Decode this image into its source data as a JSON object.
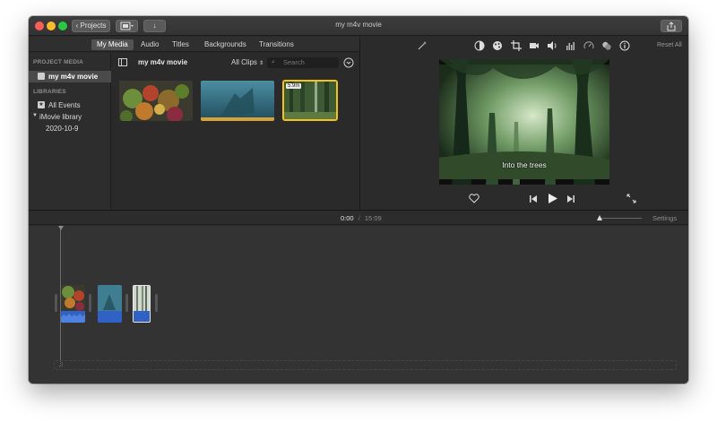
{
  "window": {
    "title": "my m4v movie",
    "projects_label": "Projects"
  },
  "browser_tabs": [
    "My Media",
    "Audio",
    "Titles",
    "Backgrounds",
    "Transitions"
  ],
  "sidebar": {
    "project_media_header": "PROJECT MEDIA",
    "project_item": "my m4v movie",
    "libraries_header": "LIBRARIES",
    "all_events": "All Events",
    "library": "iMovie library",
    "event": "2020-10-9"
  },
  "browser": {
    "title": "my m4v movie",
    "filter": "All Clips",
    "search_placeholder": "Search",
    "selected_clip_duration": "5.9m"
  },
  "viewer": {
    "reset_all": "Reset All",
    "caption": "Into the trees",
    "icons": [
      "magic-wand-icon",
      "color-balance-icon",
      "color-correction-icon",
      "crop-icon",
      "stabilization-icon",
      "volume-icon",
      "equalizer-icon",
      "speed-icon",
      "noise-reduction-icon",
      "info-icon"
    ]
  },
  "timeline": {
    "current_time": "0:00",
    "separator": "/",
    "total_time": "15:09",
    "settings_label": "Settings",
    "zoom_level": 0.05
  },
  "colors": {
    "accent_yellow": "#f3c21b",
    "audio_blue": "#2f62c4",
    "selection": "#4a4a4a"
  }
}
